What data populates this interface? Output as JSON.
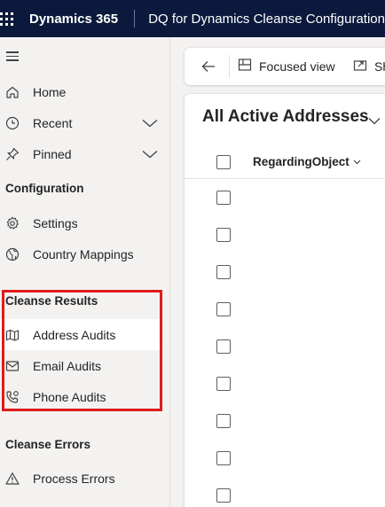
{
  "topbar": {
    "brand": "Dynamics 365",
    "app_title": "DQ for Dynamics Cleanse Configuration"
  },
  "sidebar": {
    "nav": [
      {
        "label": "Home",
        "icon": "home-icon"
      },
      {
        "label": "Recent",
        "icon": "clock-icon",
        "expandable": true
      },
      {
        "label": "Pinned",
        "icon": "pin-icon",
        "expandable": true
      }
    ],
    "sections": [
      {
        "title": "Configuration",
        "items": [
          {
            "label": "Settings",
            "icon": "gear-icon"
          },
          {
            "label": "Country Mappings",
            "icon": "globe-icon"
          }
        ]
      },
      {
        "title": "Cleanse Results",
        "items": [
          {
            "label": "Address Audits",
            "icon": "map-icon",
            "selected": true
          },
          {
            "label": "Email Audits",
            "icon": "mail-icon"
          },
          {
            "label": "Phone Audits",
            "icon": "phone-icon"
          }
        ]
      },
      {
        "title": "Cleanse Errors",
        "items": [
          {
            "label": "Process Errors",
            "icon": "warning-icon"
          }
        ]
      }
    ],
    "highlight_color": "#e01b1b"
  },
  "commandbar": {
    "focused_view": "Focused view",
    "share": "Sh"
  },
  "grid": {
    "view_title": "All Active Addresses",
    "column": "RegardingObject",
    "row_count": 9
  },
  "colors": {
    "topbar_bg": "#0b1a3c",
    "sidebar_bg": "#f3f2f1",
    "highlight": "#e01b1b"
  }
}
